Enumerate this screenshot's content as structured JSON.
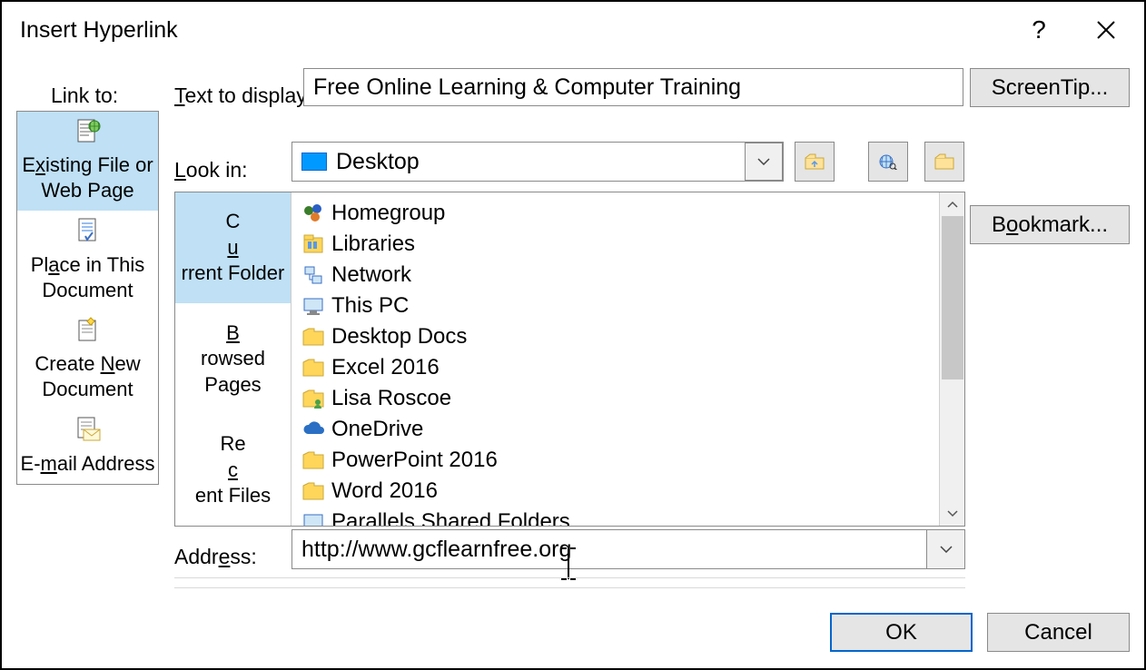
{
  "title": "Insert Hyperlink",
  "link_to_label": "Link to:",
  "sidebar": [
    {
      "label_html": "E<span class='ul-c'>x</span>isting File or Web Page"
    },
    {
      "label_html": "Pl<span class='ul-c'>a</span>ce in This Document"
    },
    {
      "label_html": "Create <span class='ul-c'>N</span>ew Document"
    },
    {
      "label_html": "E-<span class='ul-c'>m</span>ail Address"
    }
  ],
  "text_to_display": {
    "label_html": "<span class='ul-c'>T</span>ext to display:",
    "value": "Free Online Learning & Computer Training"
  },
  "look_in": {
    "label_html": "<span class='ul-c'>L</span>ook in:",
    "value": "Desktop"
  },
  "side_buttons": {
    "screentip": "ScreenTip...",
    "bookmark_html": "B<span class='ul-c'>o</span>okmark..."
  },
  "nav_column": [
    {
      "label_html": "C<span class='ul-c'>u</span>rrent Folder"
    },
    {
      "label_html": "<span class='ul-c'>B</span>rowsed Pages"
    },
    {
      "label_html": "Re<span class='ul-c'>c</span>ent Files"
    }
  ],
  "file_list": [
    {
      "name": "Homegroup",
      "icon": "homegroup"
    },
    {
      "name": "Libraries",
      "icon": "libraries"
    },
    {
      "name": "Network",
      "icon": "network"
    },
    {
      "name": "This PC",
      "icon": "thispc"
    },
    {
      "name": "Desktop Docs",
      "icon": "folder"
    },
    {
      "name": "Excel 2016",
      "icon": "folder"
    },
    {
      "name": "Lisa Roscoe",
      "icon": "userfolder"
    },
    {
      "name": "OneDrive",
      "icon": "onedrive"
    },
    {
      "name": "PowerPoint 2016",
      "icon": "folder"
    },
    {
      "name": "Word 2016",
      "icon": "folder"
    },
    {
      "name": "Parallels Shared Folders",
      "icon": "thispc"
    }
  ],
  "address": {
    "label_html": "Addr<span class='ul-c'>e</span>ss:",
    "value": "http://www.gcflearnfree.org"
  },
  "buttons": {
    "ok": "OK",
    "cancel": "Cancel"
  }
}
